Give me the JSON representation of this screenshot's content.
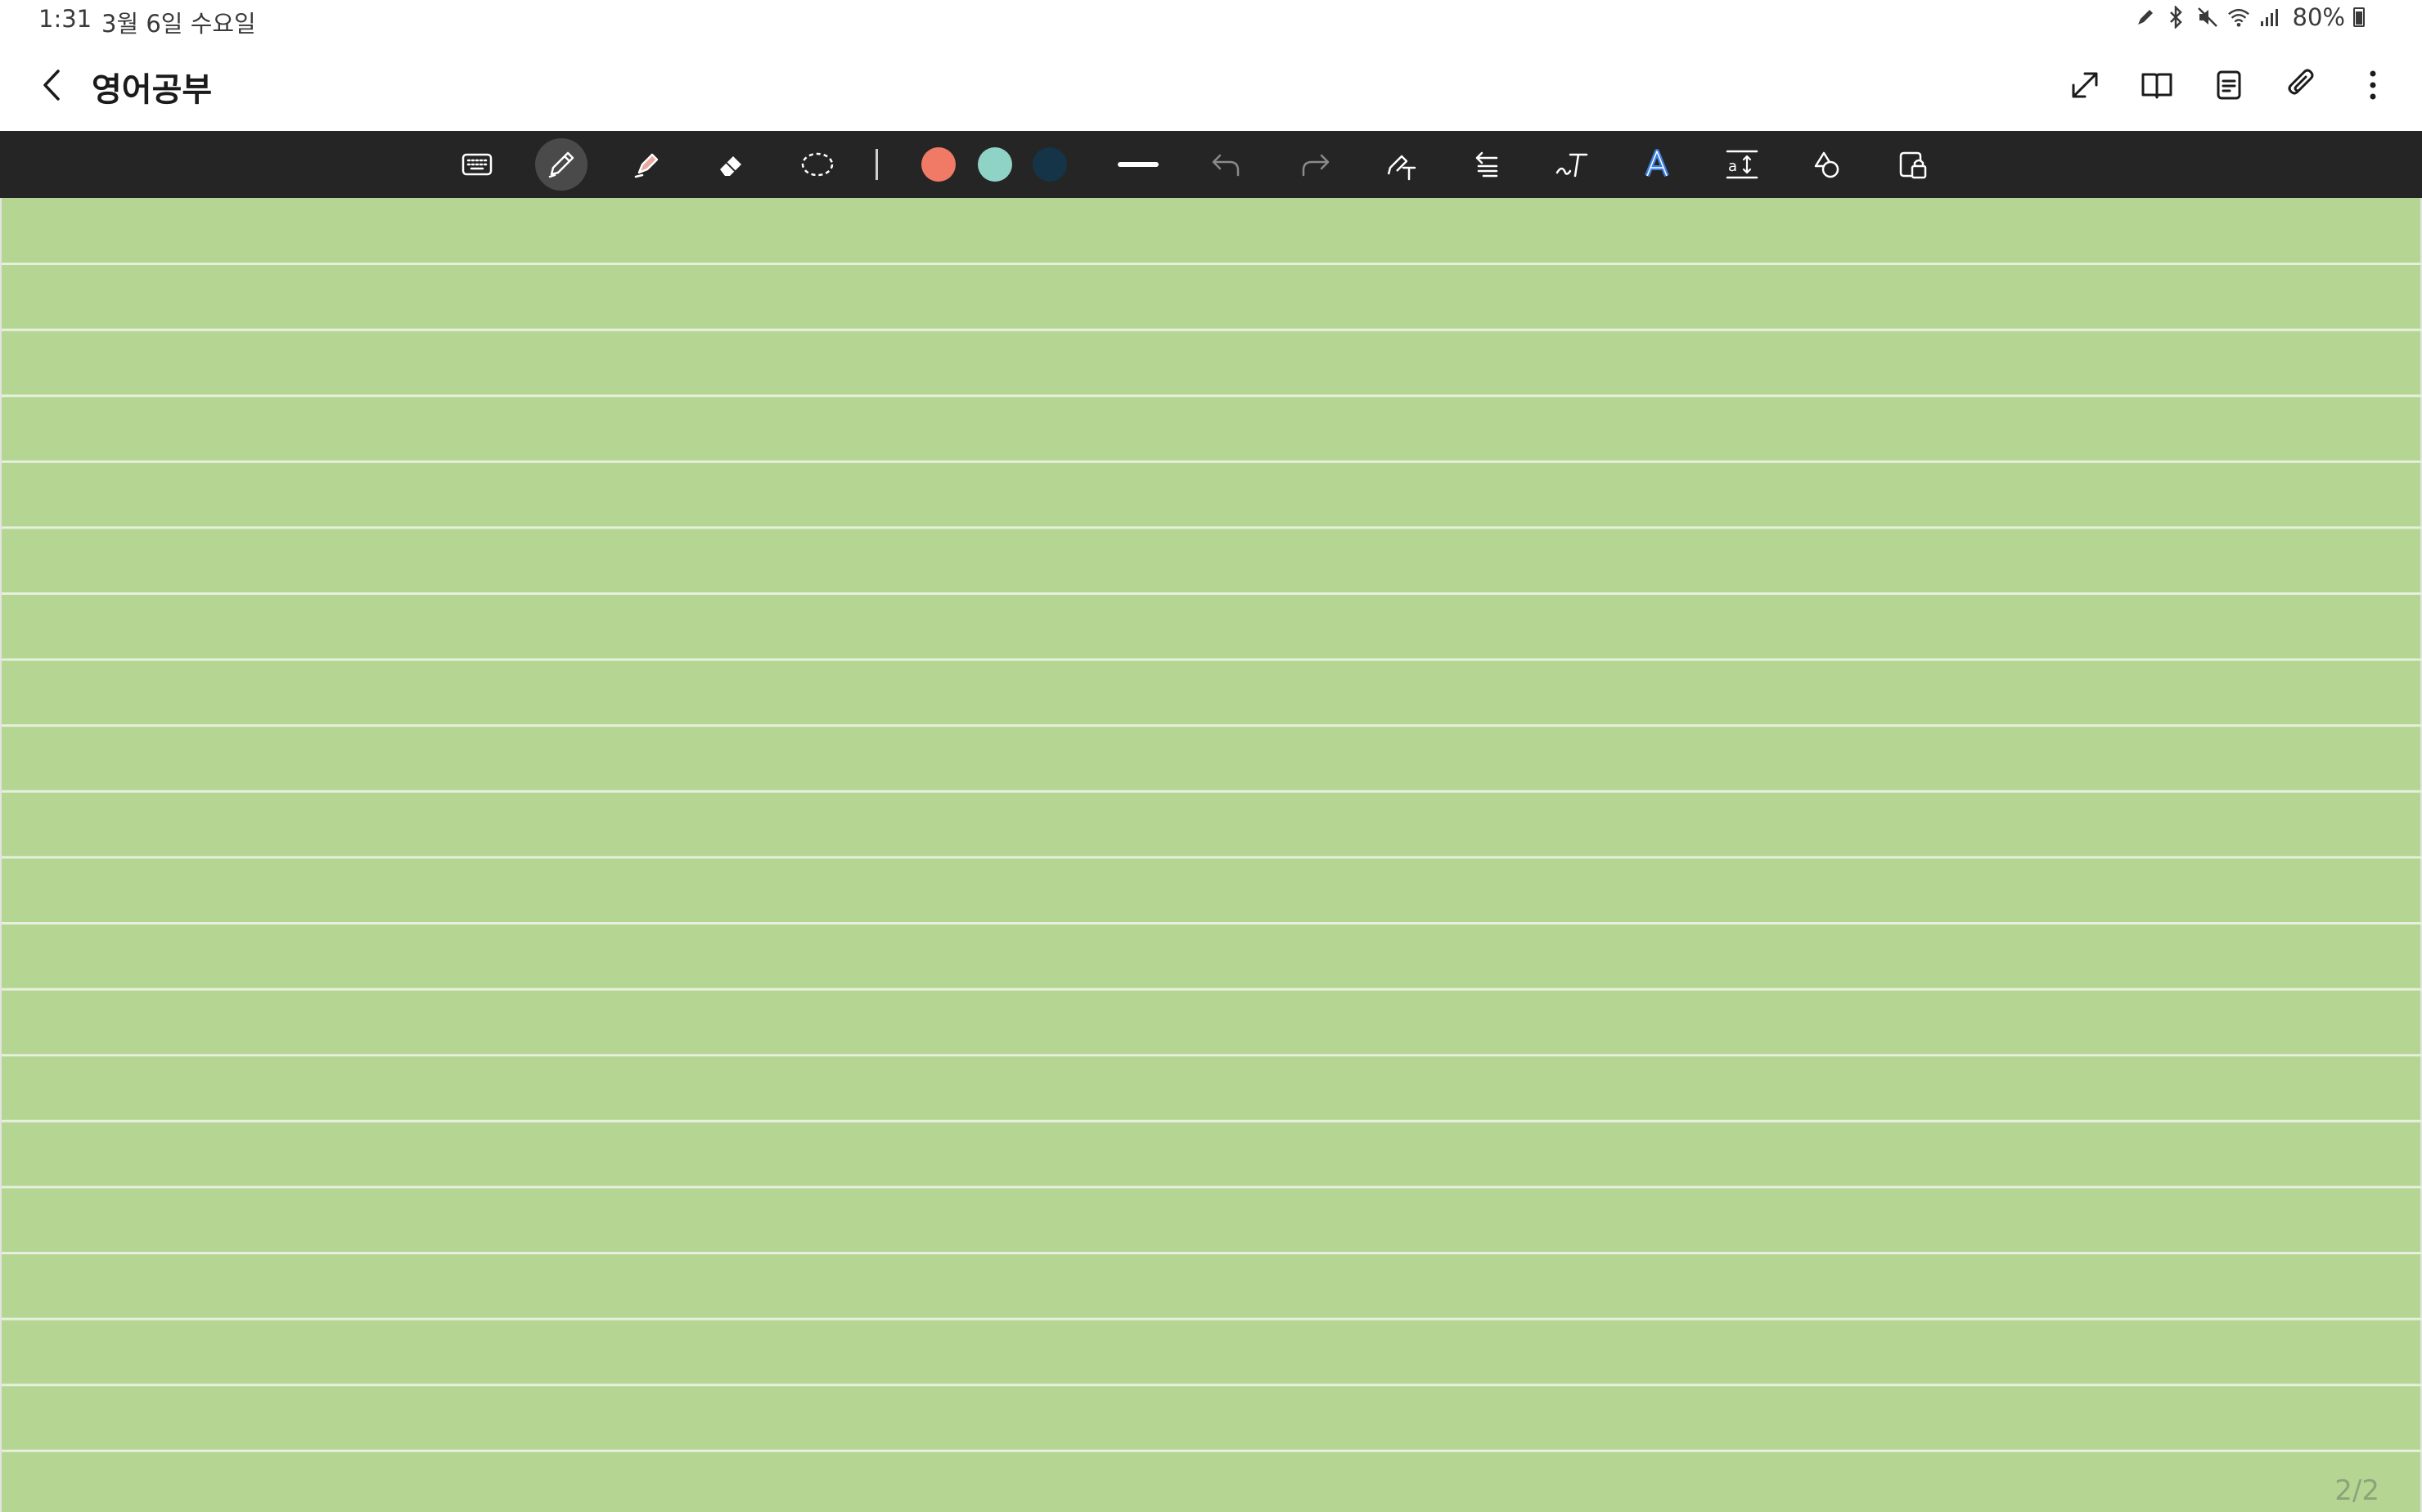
{
  "status_bar": {
    "time": "1:31",
    "date": "3월 6일 수요일",
    "battery": "80%",
    "icons": [
      "pen-icon",
      "bluetooth-icon",
      "mute-icon",
      "wifi-icon",
      "signal-icon",
      "battery-icon"
    ]
  },
  "header": {
    "title": "영어공부",
    "actions": [
      "expand-icon",
      "book-view-icon",
      "page-list-icon",
      "attachment-icon",
      "more-options-icon"
    ]
  },
  "toolbar": {
    "tools": [
      "keyboard",
      "pen",
      "highlighter",
      "eraser",
      "lasso-select",
      "undo",
      "redo",
      "shape-to-text",
      "text-align",
      "handwriting-to-text",
      "text-style",
      "text-size",
      "shapes",
      "read-only-lock"
    ],
    "active_tool": "pen",
    "colors": [
      "#f07a66",
      "#8fd2c6",
      "#153447"
    ]
  },
  "canvas": {
    "background": "#b5d593",
    "line_color": "#e6f0dc",
    "page_indicator": "2/2"
  }
}
